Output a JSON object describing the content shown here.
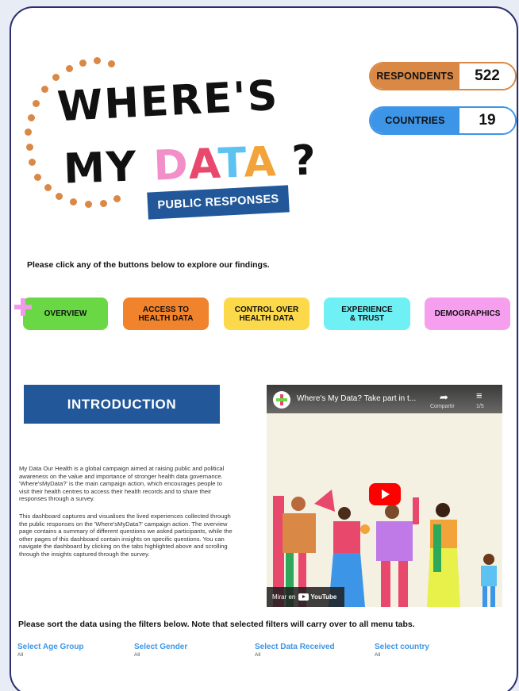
{
  "logo": {
    "line1": "WHERE'S",
    "line2_prefix": "MY",
    "line2_letters": [
      "D",
      "A",
      "T",
      "A"
    ],
    "line2_suffix": "?",
    "badge": "PUBLIC RESPONSES"
  },
  "stats": {
    "respondents_label": "RESPONDENTS",
    "respondents_value": "522",
    "countries_label": "COUNTRIES",
    "countries_value": "19"
  },
  "prompt": "Please click any of the buttons below to explore our findings.",
  "nav": {
    "overview": "OVERVIEW",
    "access": "ACCESS TO\nHEALTH DATA",
    "control": "CONTROL OVER\nHEALTH DATA",
    "experience": "EXPERIENCE\n& TRUST",
    "demographics": "DEMOGRAPHICS"
  },
  "intro": {
    "title": "INTRODUCTION",
    "paragraph1": "My Data Our Health is a global campaign aimed at raising public and political awareness on the value and importance of stronger health data governance. 'Where'sMyData?' is the main campaign action, which encourages people to visit their health centres to access their health records and to share their responses through a survey.",
    "paragraph2": "This dashboard captures and visualises the lived experiences collected through the public responses on the 'Where'sMyData?' campaign action. The overview page contains a summary of different questions we asked participants, while the other pages of this dashboard contain insights on specific questions. You can navigate the dashboard by clicking on the tabs highlighted above and scrolling through the insights  captured through the survey."
  },
  "video": {
    "title": "Where's My Data?  Take part in t...",
    "share_label": "Compartir",
    "playlist_count": "1/5",
    "watch_on": "Mirar en",
    "youtube": "YouTube"
  },
  "filters": {
    "prompt": "Please sort the data using the filters below. Note that selected filters will carry over to all menu tabs.",
    "items": [
      {
        "label": "Select Age Group",
        "value": "All"
      },
      {
        "label": "Select Gender",
        "value": "All"
      },
      {
        "label": "Select Data Received",
        "value": "All"
      },
      {
        "label": "Select country",
        "value": "All"
      }
    ]
  }
}
